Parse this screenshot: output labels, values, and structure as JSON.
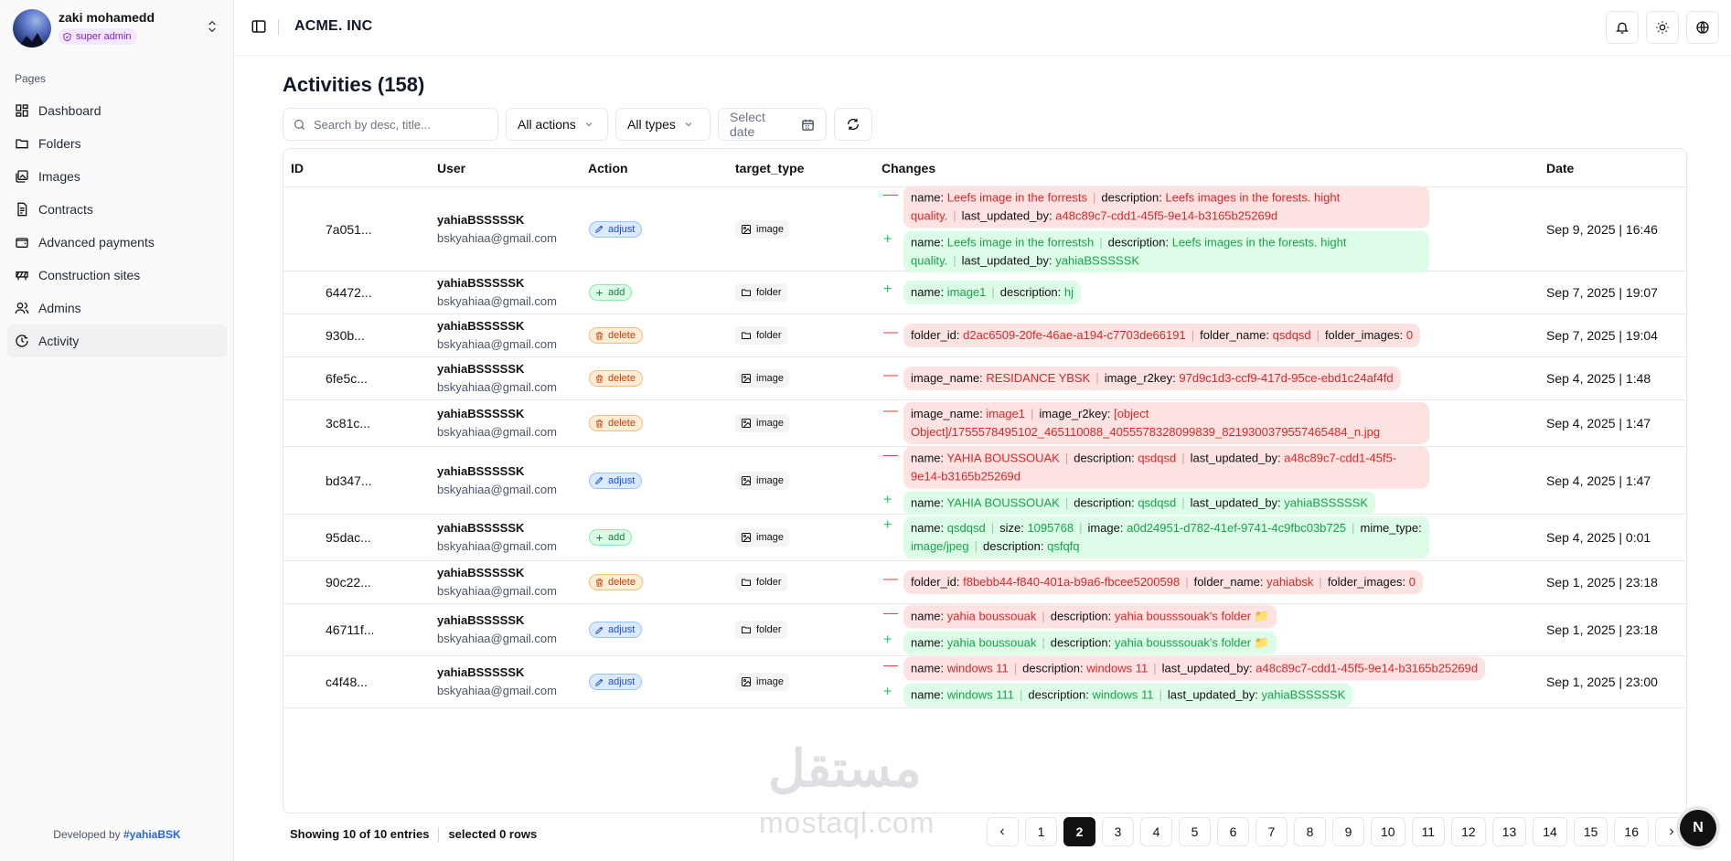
{
  "user": {
    "name": "zaki mohamedd",
    "role": "super admin"
  },
  "nav_section": "Pages",
  "nav": [
    {
      "label": "Dashboard",
      "icon": "dashboard-icon"
    },
    {
      "label": "Folders",
      "icon": "folder-icon"
    },
    {
      "label": "Images",
      "icon": "images-icon"
    },
    {
      "label": "Contracts",
      "icon": "contract-icon"
    },
    {
      "label": "Advanced payments",
      "icon": "wallet-icon"
    },
    {
      "label": "Construction sites",
      "icon": "construction-icon"
    },
    {
      "label": "Admins",
      "icon": "users-icon"
    },
    {
      "label": "Activity",
      "icon": "activity-icon",
      "active": true
    }
  ],
  "developed_by": {
    "prefix": "Developed by ",
    "handle": "#yahiaBSK"
  },
  "brand": "ACME. INC",
  "page_title": "Activities (158)",
  "toolbar": {
    "search_placeholder": "Search by desc, title...",
    "actions_filter": "All actions",
    "types_filter": "All types",
    "date_placeholder": "Select date"
  },
  "columns": {
    "id": "ID",
    "user": "User",
    "action": "Action",
    "target_type": "target_type",
    "changes": "Changes",
    "date": "Date"
  },
  "rows": [
    {
      "id": "7a051...",
      "user": "yahiaBSSSSSK",
      "email": "bskyahiaa@gmail.com",
      "action": "adjust",
      "target": "image",
      "date": "Sep 9, 2025 | 16:46",
      "changes": [
        {
          "kind": "del",
          "fields": [
            {
              "k": "name",
              "v": "Leefs image in the forrests"
            },
            {
              "k": "description",
              "v": "Leefs images in the forests. hight quality."
            },
            {
              "k": "last_updated_by",
              "v": "a48c89c7-cdd1-45f5-9e14-b3165b25269d"
            }
          ]
        },
        {
          "kind": "ins",
          "fields": [
            {
              "k": "name",
              "v": "Leefs image in the forrestsh"
            },
            {
              "k": "description",
              "v": "Leefs images in the forests. hight quality."
            },
            {
              "k": "last_updated_by",
              "v": "yahiaBSSSSSK"
            }
          ]
        }
      ]
    },
    {
      "id": "64472...",
      "user": "yahiaBSSSSSK",
      "email": "bskyahiaa@gmail.com",
      "action": "add",
      "target": "folder",
      "date": "Sep 7, 2025 | 19:07",
      "changes": [
        {
          "kind": "ins",
          "fields": [
            {
              "k": "name",
              "v": "image1"
            },
            {
              "k": "description",
              "v": "hj"
            }
          ]
        }
      ]
    },
    {
      "id": "930b...",
      "user": "yahiaBSSSSSK",
      "email": "bskyahiaa@gmail.com",
      "action": "delete",
      "target": "folder",
      "date": "Sep 7, 2025 | 19:04",
      "changes": [
        {
          "kind": "del",
          "fields": [
            {
              "k": "folder_id",
              "v": "d2ac6509-20fe-46ae-a194-c7703de66191"
            },
            {
              "k": "folder_name",
              "v": "qsdqsd"
            },
            {
              "k": "folder_images",
              "v": "0"
            }
          ]
        }
      ]
    },
    {
      "id": "6fe5c...",
      "user": "yahiaBSSSSSK",
      "email": "bskyahiaa@gmail.com",
      "action": "delete",
      "target": "image",
      "date": "Sep 4, 2025 | 1:48",
      "changes": [
        {
          "kind": "del",
          "fields": [
            {
              "k": "image_name",
              "v": "RESIDANCE YBSK"
            },
            {
              "k": "image_r2key",
              "v": "97d9c1d3-ccf9-417d-95ce-ebd1c24af4fd"
            }
          ]
        }
      ]
    },
    {
      "id": "3c81c...",
      "user": "yahiaBSSSSSK",
      "email": "bskyahiaa@gmail.com",
      "action": "delete",
      "target": "image",
      "date": "Sep 4, 2025 | 1:47",
      "changes": [
        {
          "kind": "del",
          "fields": [
            {
              "k": "image_name",
              "v": "image1"
            },
            {
              "k": "image_r2key",
              "v": "[object Object]/1755578495102_465110088_4055578328099839_8219300379557465484_n.jpg"
            }
          ]
        }
      ]
    },
    {
      "id": "bd347...",
      "user": "yahiaBSSSSSK",
      "email": "bskyahiaa@gmail.com",
      "action": "adjust",
      "target": "image",
      "date": "Sep 4, 2025 | 1:47",
      "changes": [
        {
          "kind": "del",
          "fields": [
            {
              "k": "name",
              "v": "YAHIA BOUSSOUAK"
            },
            {
              "k": "description",
              "v": "qsdqsd"
            },
            {
              "k": "last_updated_by",
              "v": "a48c89c7-cdd1-45f5-9e14-b3165b25269d"
            }
          ]
        },
        {
          "kind": "ins",
          "fields": [
            {
              "k": "name",
              "v": "YAHIA BOUSSOUAK"
            },
            {
              "k": "description",
              "v": "qsdqsd"
            },
            {
              "k": "last_updated_by",
              "v": "yahiaBSSSSSK"
            }
          ]
        }
      ]
    },
    {
      "id": "95dac...",
      "user": "yahiaBSSSSSK",
      "email": "bskyahiaa@gmail.com",
      "action": "add",
      "target": "image",
      "date": "Sep 4, 2025 | 0:01",
      "changes": [
        {
          "kind": "ins",
          "fields": [
            {
              "k": "name",
              "v": "qsdqsd"
            },
            {
              "k": "size",
              "v": "1095768"
            },
            {
              "k": "image",
              "v": "a0d24951-d782-41ef-9741-4c9fbc03b725"
            },
            {
              "k": "mime_type",
              "v": "image/jpeg"
            },
            {
              "k": "description",
              "v": "qsfqfq"
            }
          ]
        }
      ]
    },
    {
      "id": "90c22...",
      "user": "yahiaBSSSSSK",
      "email": "bskyahiaa@gmail.com",
      "action": "delete",
      "target": "folder",
      "date": "Sep 1, 2025 | 23:18",
      "changes": [
        {
          "kind": "del",
          "fields": [
            {
              "k": "folder_id",
              "v": "f8bebb44-f840-401a-b9a6-fbcee5200598"
            },
            {
              "k": "folder_name",
              "v": "yahiabsk"
            },
            {
              "k": "folder_images",
              "v": "0"
            }
          ]
        }
      ]
    },
    {
      "id": "46711f...",
      "user": "yahiaBSSSSSK",
      "email": "bskyahiaa@gmail.com",
      "action": "adjust",
      "target": "folder",
      "date": "Sep 1, 2025 | 23:18",
      "changes": [
        {
          "kind": "del",
          "fields": [
            {
              "k": "name",
              "v": "yahia boussouak"
            },
            {
              "k": "description",
              "v": "yahia bousssouak's folder 📁"
            }
          ]
        },
        {
          "kind": "ins",
          "fields": [
            {
              "k": "name",
              "v": "yahia boussouak"
            },
            {
              "k": "description",
              "v": "yahia bousssouak's folder 📁"
            }
          ]
        }
      ]
    },
    {
      "id": "c4f48...",
      "user": "yahiaBSSSSSK",
      "email": "bskyahiaa@gmail.com",
      "action": "adjust",
      "target": "image",
      "date": "Sep 1, 2025 | 23:00",
      "changes": [
        {
          "kind": "del",
          "fields": [
            {
              "k": "name",
              "v": "windows 11"
            },
            {
              "k": "description",
              "v": "windows 11"
            },
            {
              "k": "last_updated_by",
              "v": "a48c89c7-cdd1-45f5-9e14-b3165b25269d"
            }
          ]
        },
        {
          "kind": "ins",
          "fields": [
            {
              "k": "name",
              "v": "windows 111"
            },
            {
              "k": "description",
              "v": "windows 11"
            },
            {
              "k": "last_updated_by",
              "v": "yahiaBSSSSSK"
            }
          ]
        }
      ]
    }
  ],
  "footer": {
    "showing": "Showing 10 of 10 entries",
    "selected": "selected 0 rows"
  },
  "pagination": {
    "pages": [
      "1",
      "2",
      "3",
      "4",
      "5",
      "6",
      "7",
      "8",
      "9",
      "10",
      "11",
      "12",
      "13",
      "14",
      "15",
      "16"
    ],
    "current": "2"
  },
  "fab_label": "N",
  "watermark": {
    "arabic": "مستقل",
    "latin": "mostaql.com"
  },
  "colors": {
    "accent_adjust": "#1d4ed8",
    "accent_add": "#15803d",
    "accent_delete": "#c2410c",
    "removed": "#dc2626",
    "inserted": "#16a34a"
  }
}
